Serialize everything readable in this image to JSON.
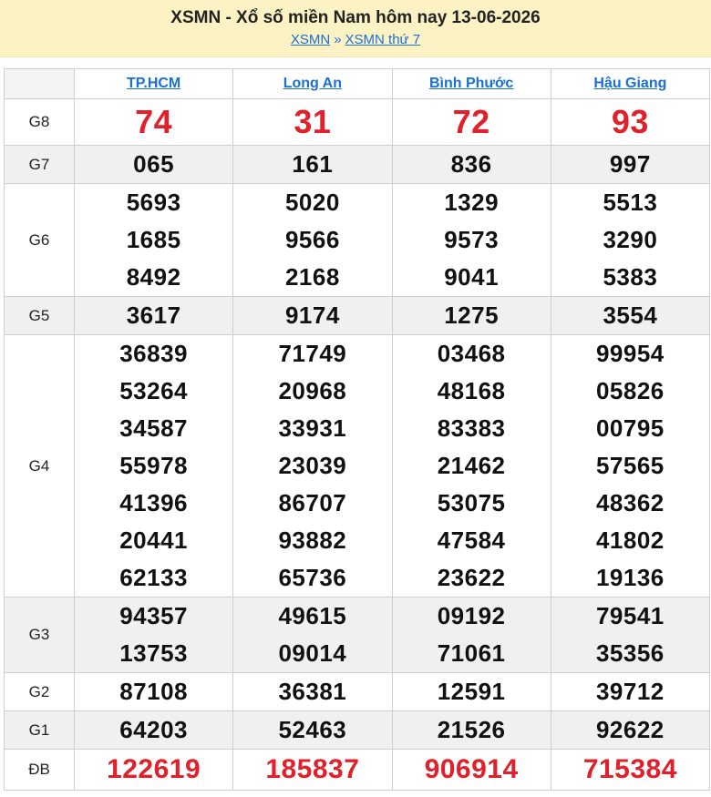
{
  "header": {
    "title": "XSMN - Xổ số miền Nam hôm nay 13-06-2026",
    "crumb1": "XSMN",
    "sep": "»",
    "crumb2": "XSMN thứ 7"
  },
  "provinces": [
    "TP.HCM",
    "Long An",
    "Bình Phước",
    "Hậu Giang"
  ],
  "prizes": [
    {
      "label": "G8",
      "values": [
        [
          "74"
        ],
        [
          "31"
        ],
        [
          "72"
        ],
        [
          "93"
        ]
      ]
    },
    {
      "label": "G7",
      "values": [
        [
          "065"
        ],
        [
          "161"
        ],
        [
          "836"
        ],
        [
          "997"
        ]
      ]
    },
    {
      "label": "G6",
      "values": [
        [
          "5693",
          "1685",
          "8492"
        ],
        [
          "5020",
          "9566",
          "2168"
        ],
        [
          "1329",
          "9573",
          "9041"
        ],
        [
          "5513",
          "3290",
          "5383"
        ]
      ]
    },
    {
      "label": "G5",
      "values": [
        [
          "3617"
        ],
        [
          "9174"
        ],
        [
          "1275"
        ],
        [
          "3554"
        ]
      ]
    },
    {
      "label": "G4",
      "values": [
        [
          "36839",
          "53264",
          "34587",
          "55978",
          "41396",
          "20441",
          "62133"
        ],
        [
          "71749",
          "20968",
          "33931",
          "23039",
          "86707",
          "93882",
          "65736"
        ],
        [
          "03468",
          "48168",
          "83383",
          "21462",
          "53075",
          "47584",
          "23622"
        ],
        [
          "99954",
          "05826",
          "00795",
          "57565",
          "48362",
          "41802",
          "19136"
        ]
      ]
    },
    {
      "label": "G3",
      "values": [
        [
          "94357",
          "13753"
        ],
        [
          "49615",
          "09014"
        ],
        [
          "09192",
          "71061"
        ],
        [
          "79541",
          "35356"
        ]
      ]
    },
    {
      "label": "G2",
      "values": [
        [
          "87108"
        ],
        [
          "36381"
        ],
        [
          "12591"
        ],
        [
          "39712"
        ]
      ]
    },
    {
      "label": "G1",
      "values": [
        [
          "64203"
        ],
        [
          "52463"
        ],
        [
          "21526"
        ],
        [
          "92622"
        ]
      ]
    },
    {
      "label": "ĐB",
      "values": [
        [
          "122619"
        ],
        [
          "185837"
        ],
        [
          "906914"
        ],
        [
          "715384"
        ]
      ]
    }
  ]
}
